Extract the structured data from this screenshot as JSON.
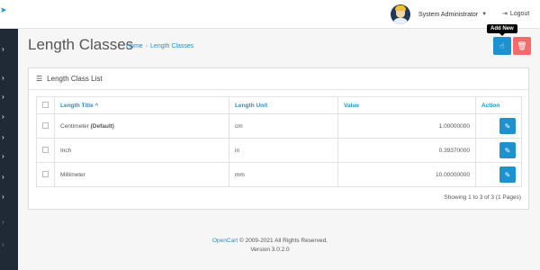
{
  "header": {
    "user_name": "System Administrator",
    "logout_label": "Logout",
    "icons": {
      "caret": "caret-down-icon",
      "logout": "sign-out-icon"
    }
  },
  "sidebar": {
    "items": [
      {
        "icon": "chevron-right-icon"
      },
      {
        "icon": "chevron-right-icon"
      },
      {
        "icon": "chevron-right-icon"
      },
      {
        "icon": "chevron-right-icon"
      },
      {
        "icon": "chevron-right-icon"
      },
      {
        "icon": "chevron-right-icon"
      },
      {
        "icon": "chevron-right-icon"
      },
      {
        "icon": "chevron-right-icon"
      },
      {
        "icon": "chevron-right-icon"
      }
    ]
  },
  "page": {
    "title": "Length Classes",
    "breadcrumb": {
      "home": "Home",
      "current": "Length Classes"
    },
    "add_tooltip": "Add New"
  },
  "panel": {
    "heading": "Length Class List",
    "columns": {
      "title": "Length Title",
      "unit": "Length Unit",
      "value": "Value",
      "action": "Action"
    },
    "rows": [
      {
        "title": "Centimeter",
        "default_tag": "(Default)",
        "unit": "cm",
        "value": "1.00000000"
      },
      {
        "title": "Inch",
        "default_tag": "",
        "unit": "in",
        "value": "0.39370000"
      },
      {
        "title": "Millimeter",
        "default_tag": "",
        "unit": "mm",
        "value": "10.00000000"
      }
    ],
    "pagination": "Showing 1 to 3 of 3 (1 Pages)"
  },
  "footer": {
    "brand": "OpenCart",
    "copyright": "© 2009-2021 All Rights Reserved.",
    "version": "Version 3.0.2.0"
  },
  "colors": {
    "accent": "#1e91cf",
    "danger": "#f56b6b",
    "sidebar": "#1f2a36"
  }
}
